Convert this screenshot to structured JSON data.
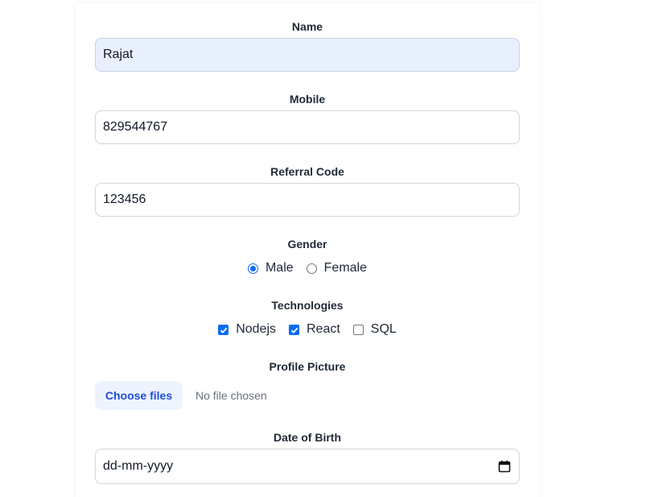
{
  "form": {
    "name": {
      "label": "Name",
      "value": "Rajat"
    },
    "mobile": {
      "label": "Mobile",
      "value": "829544767"
    },
    "referral": {
      "label": "Referral Code",
      "value": "123456"
    },
    "gender": {
      "label": "Gender",
      "options": [
        {
          "label": "Male",
          "selected": true
        },
        {
          "label": "Female",
          "selected": false
        }
      ]
    },
    "technologies": {
      "label": "Technologies",
      "options": [
        {
          "label": "Nodejs",
          "checked": true
        },
        {
          "label": "React",
          "checked": true
        },
        {
          "label": "SQL",
          "checked": false
        }
      ]
    },
    "profile_picture": {
      "label": "Profile Picture",
      "button_label": "Choose files",
      "status": "No file chosen"
    },
    "dob": {
      "label": "Date of Birth",
      "placeholder": "dd-mm-yyyy",
      "icon": "calendar-icon"
    }
  },
  "colors": {
    "accent": "#0b6bf5",
    "file_button_bg": "#eef4ff",
    "file_button_text": "#1d4ed8",
    "autofill_bg": "#e8f0fe"
  }
}
